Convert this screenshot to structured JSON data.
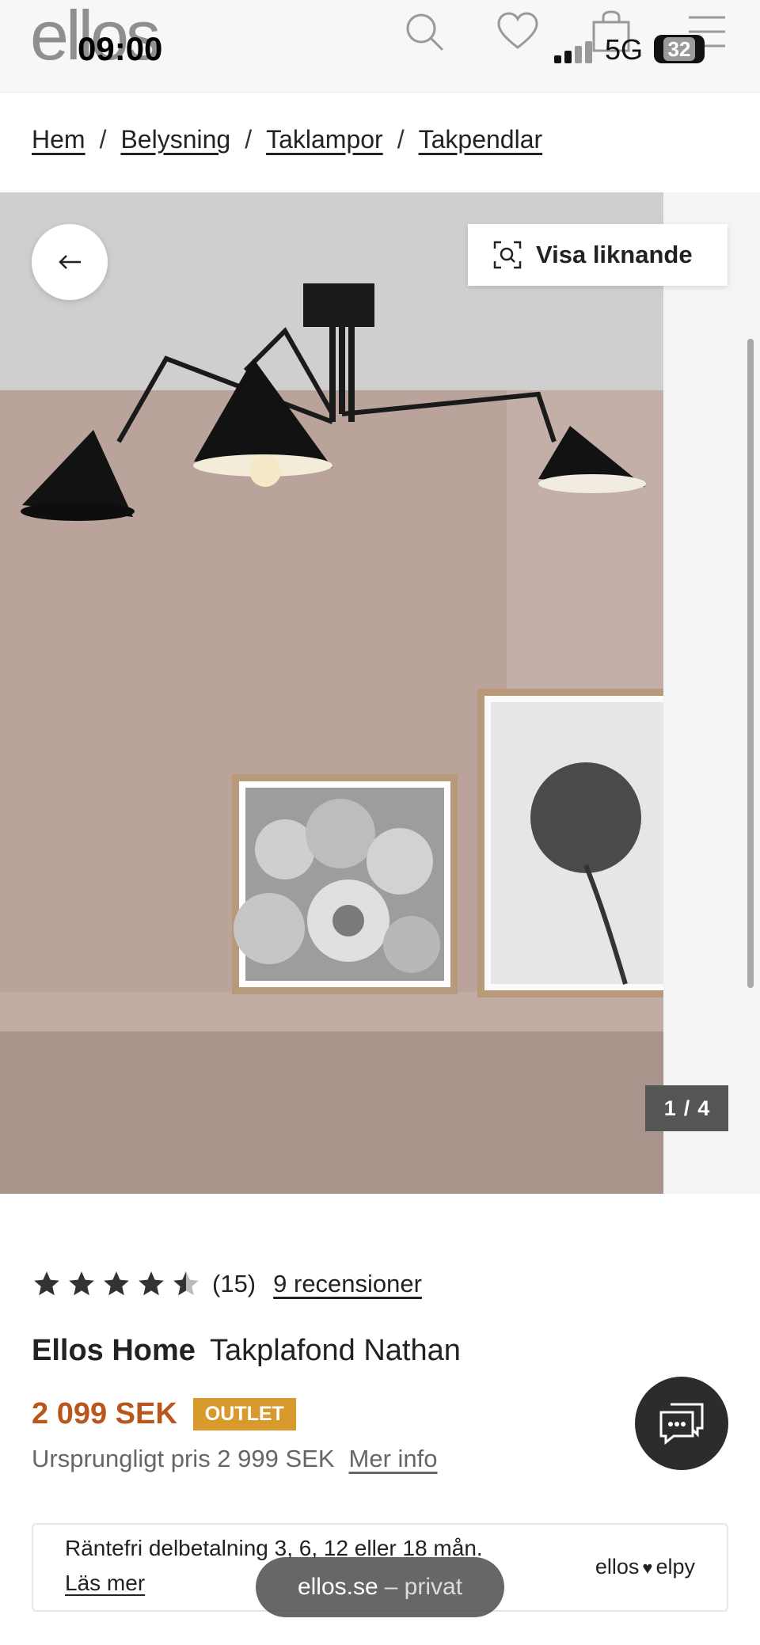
{
  "status_bar": {
    "time": "09:00",
    "network": "5G",
    "battery": "32"
  },
  "header": {
    "logo": "ellos",
    "icons": [
      "search-icon",
      "heart-icon",
      "bag-icon",
      "menu-icon"
    ]
  },
  "breadcrumb": [
    "Hem",
    "Belysning",
    "Taklampor",
    "Takpendlar"
  ],
  "breadcrumb_separator": "/",
  "gallery": {
    "similar_label": "Visa liknande",
    "current": "1",
    "separator": "/",
    "total": "4"
  },
  "product": {
    "rating": 4.5,
    "rating_count": "(15)",
    "reviews_link": "9 recensioner",
    "brand": "Ellos Home",
    "name": "Takplafond Nathan",
    "price": "2 099 SEK",
    "badge": "OUTLET",
    "original_price": "Ursprungligt pris 2 999 SEK",
    "more_info": "Mer info"
  },
  "financing": {
    "text": "Räntefri delbetalning 3, 6, 12 eller 18 mån.",
    "read_more": "Läs mer",
    "partner_left": "ellos",
    "partner_right": "elpy"
  },
  "domain_pill": {
    "site": "ellos.se",
    "suffix": "– privat"
  },
  "colors": {
    "price": "#b8561d",
    "badge": "#d89a2c",
    "chat": "#2c2c2c"
  }
}
